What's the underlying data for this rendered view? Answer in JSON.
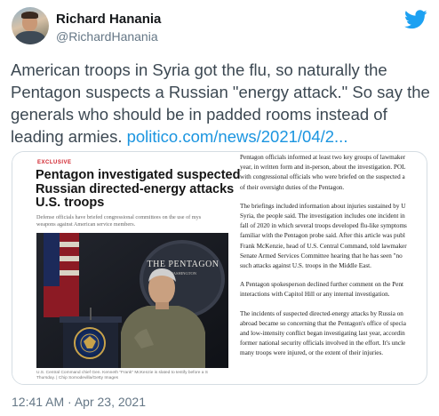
{
  "author": {
    "name": "Richard Hanania",
    "handle": "@RichardHanania"
  },
  "tweet": {
    "text": "American troops in Syria got the flu, so naturally the Pentagon suspects a Russian \"energy attack.\" So say the generals who should be in padded rooms instead of leading armies. ",
    "link_text": "politico.com/news/2021/04/2..."
  },
  "card": {
    "tag": "EXCLUSIVE",
    "headline_lines": [
      "Pentagon investigated suspected",
      "Russian directed-energy attacks",
      "U.S. troops"
    ],
    "dek_lines": [
      "Defense officials have briefed congressional committees on the use of mys",
      "weapons against American service members."
    ],
    "podium_sign": "THE PENTAGON",
    "podium_sign_sub": "WASHINGTON",
    "caption_lines": [
      "U.S. Central Command chief Gen. Kenneth \"Frank\" McKenzie is slated to testify before a S",
      "Thursday. | Chip Somodevilla/Getty Images"
    ],
    "body_paragraphs": [
      [
        "Pentagon officials informed at least two key groups of lawmaker",
        "year, in written form and in-person, about the investigation. POL",
        "with congressional officials who were briefed on the suspected a",
        "of their oversight duties of the Pentagon."
      ],
      [
        "The briefings included information about injuries sustained by U",
        "Syria, the people said. The investigation includes one incident in",
        "fall of 2020 in which several troops developed flu-like symptoms",
        "familiar with the Pentagon probe said. After this article was publ",
        "Frank McKenzie, head of U.S. Central Command, told lawmaker",
        "Senate Armed Services Committee hearing that he has seen \"no",
        "such attacks against U.S. troops in the Middle East."
      ],
      [
        "A Pentagon spokesperson declined further comment on the Pent",
        "interactions with Capitol Hill or any internal investigation."
      ],
      [
        "The incidents of suspected directed-energy attacks by Russia on",
        "abroad became so concerning that the Pentagon's office of specia",
        "and low-intensity conflict began investigating last year, accordin",
        "former national security officials involved in the effort. It's uncle",
        "many troops were injured, or the extent of their injuries."
      ]
    ]
  },
  "timestamp": "12:41 AM · Apr 23, 2021",
  "colors": {
    "link": "#1b95e0",
    "twitter_blue": "#1da1f2",
    "exclusive_red": "#d0202a",
    "secondary_text": "#657786"
  },
  "icons": {
    "brand": "twitter-bird-icon",
    "avatar": "profile-photo"
  }
}
